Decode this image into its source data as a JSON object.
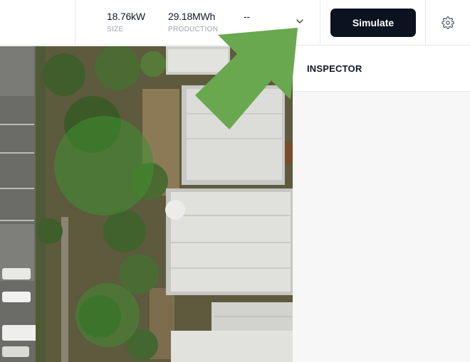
{
  "header": {
    "size_value": "18.76kW",
    "size_label": "SIZE",
    "production_value": "29.18MWh",
    "production_label": "PRODUCTION",
    "third_value": "--",
    "simulate_label": "Simulate"
  },
  "icons": {
    "dropdown": "chevron-down-icon",
    "settings": "gear-icon",
    "overlay": "arrow-icon"
  },
  "inspector": {
    "title": "INSPECTOR"
  },
  "colors": {
    "primary_button": "#0b1220",
    "arrow": "#6aa84f",
    "tree_highlight": "#3f8f2f"
  }
}
